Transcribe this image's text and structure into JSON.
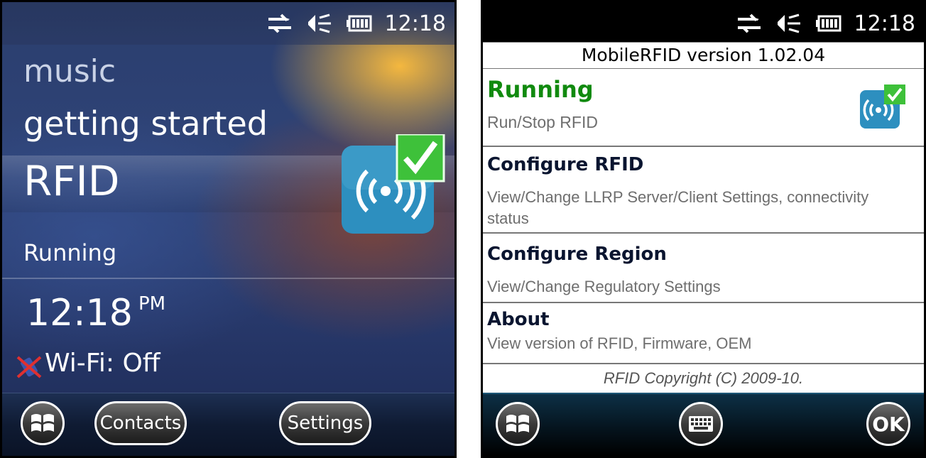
{
  "left_screen": {
    "status_bar": {
      "time": "12:18",
      "icons": [
        "sync-arrows-icon",
        "speaker-icon",
        "battery-icon"
      ]
    },
    "home_items": {
      "music": "music",
      "getting_started": "getting started",
      "rfid": "RFID",
      "rfid_status": "Running"
    },
    "clock": {
      "time": "12:18",
      "ampm": "PM"
    },
    "wifi_status": "Wi-Fi: Off",
    "softkeys": {
      "left": "Contacts",
      "right": "Settings"
    }
  },
  "right_screen": {
    "status_bar": {
      "time": "12:18",
      "icons": [
        "sync-arrows-icon",
        "speaker-icon",
        "battery-icon"
      ]
    },
    "app_title": "MobileRFID version 1.02.04",
    "items": [
      {
        "title": "Running",
        "description": "Run/Stop RFID"
      },
      {
        "title": "Configure RFID",
        "description": "View/Change LLRP Server/Client Settings, connectivity status"
      },
      {
        "title": "Configure Region",
        "description": "View/Change Regulatory Settings"
      },
      {
        "title": "About",
        "description": "View version of RFID, Firmware, OEM"
      }
    ],
    "copyright": "RFID Copyright (C) 2009-10.",
    "softkeys": {
      "right": "OK"
    }
  },
  "colors": {
    "running_green": "#118a0f",
    "check_green": "#3ec13a",
    "rfid_icon_blue": "#2d8fbf"
  }
}
